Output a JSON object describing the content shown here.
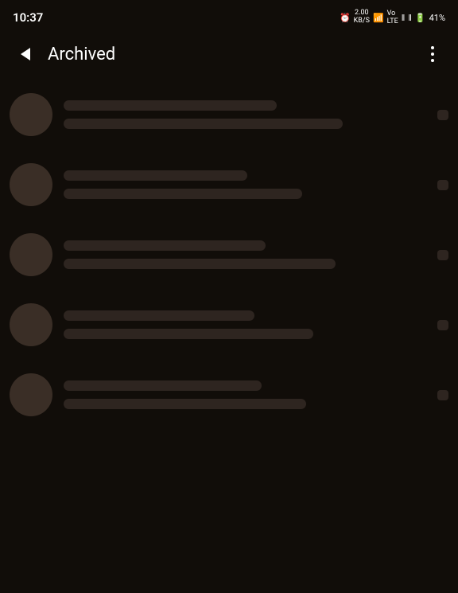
{
  "statusBar": {
    "time": "10:37",
    "battery": "41%",
    "batteryIcon": "battery-icon",
    "wifiIcon": "wifi-icon",
    "signalIcon": "signal-icon"
  },
  "appBar": {
    "title": "Archived",
    "backLabel": "back",
    "moreLabel": "more-options"
  },
  "chatList": {
    "items": [
      {
        "id": 1,
        "lineWidths": [
          "58%",
          "76%"
        ]
      },
      {
        "id": 2,
        "lineWidths": [
          "50%",
          "65%"
        ]
      },
      {
        "id": 3,
        "lineWidths": [
          "55%",
          "74%"
        ]
      },
      {
        "id": 4,
        "lineWidths": [
          "52%",
          "68%"
        ]
      },
      {
        "id": 5,
        "lineWidths": [
          "54%",
          "66%"
        ]
      }
    ]
  }
}
